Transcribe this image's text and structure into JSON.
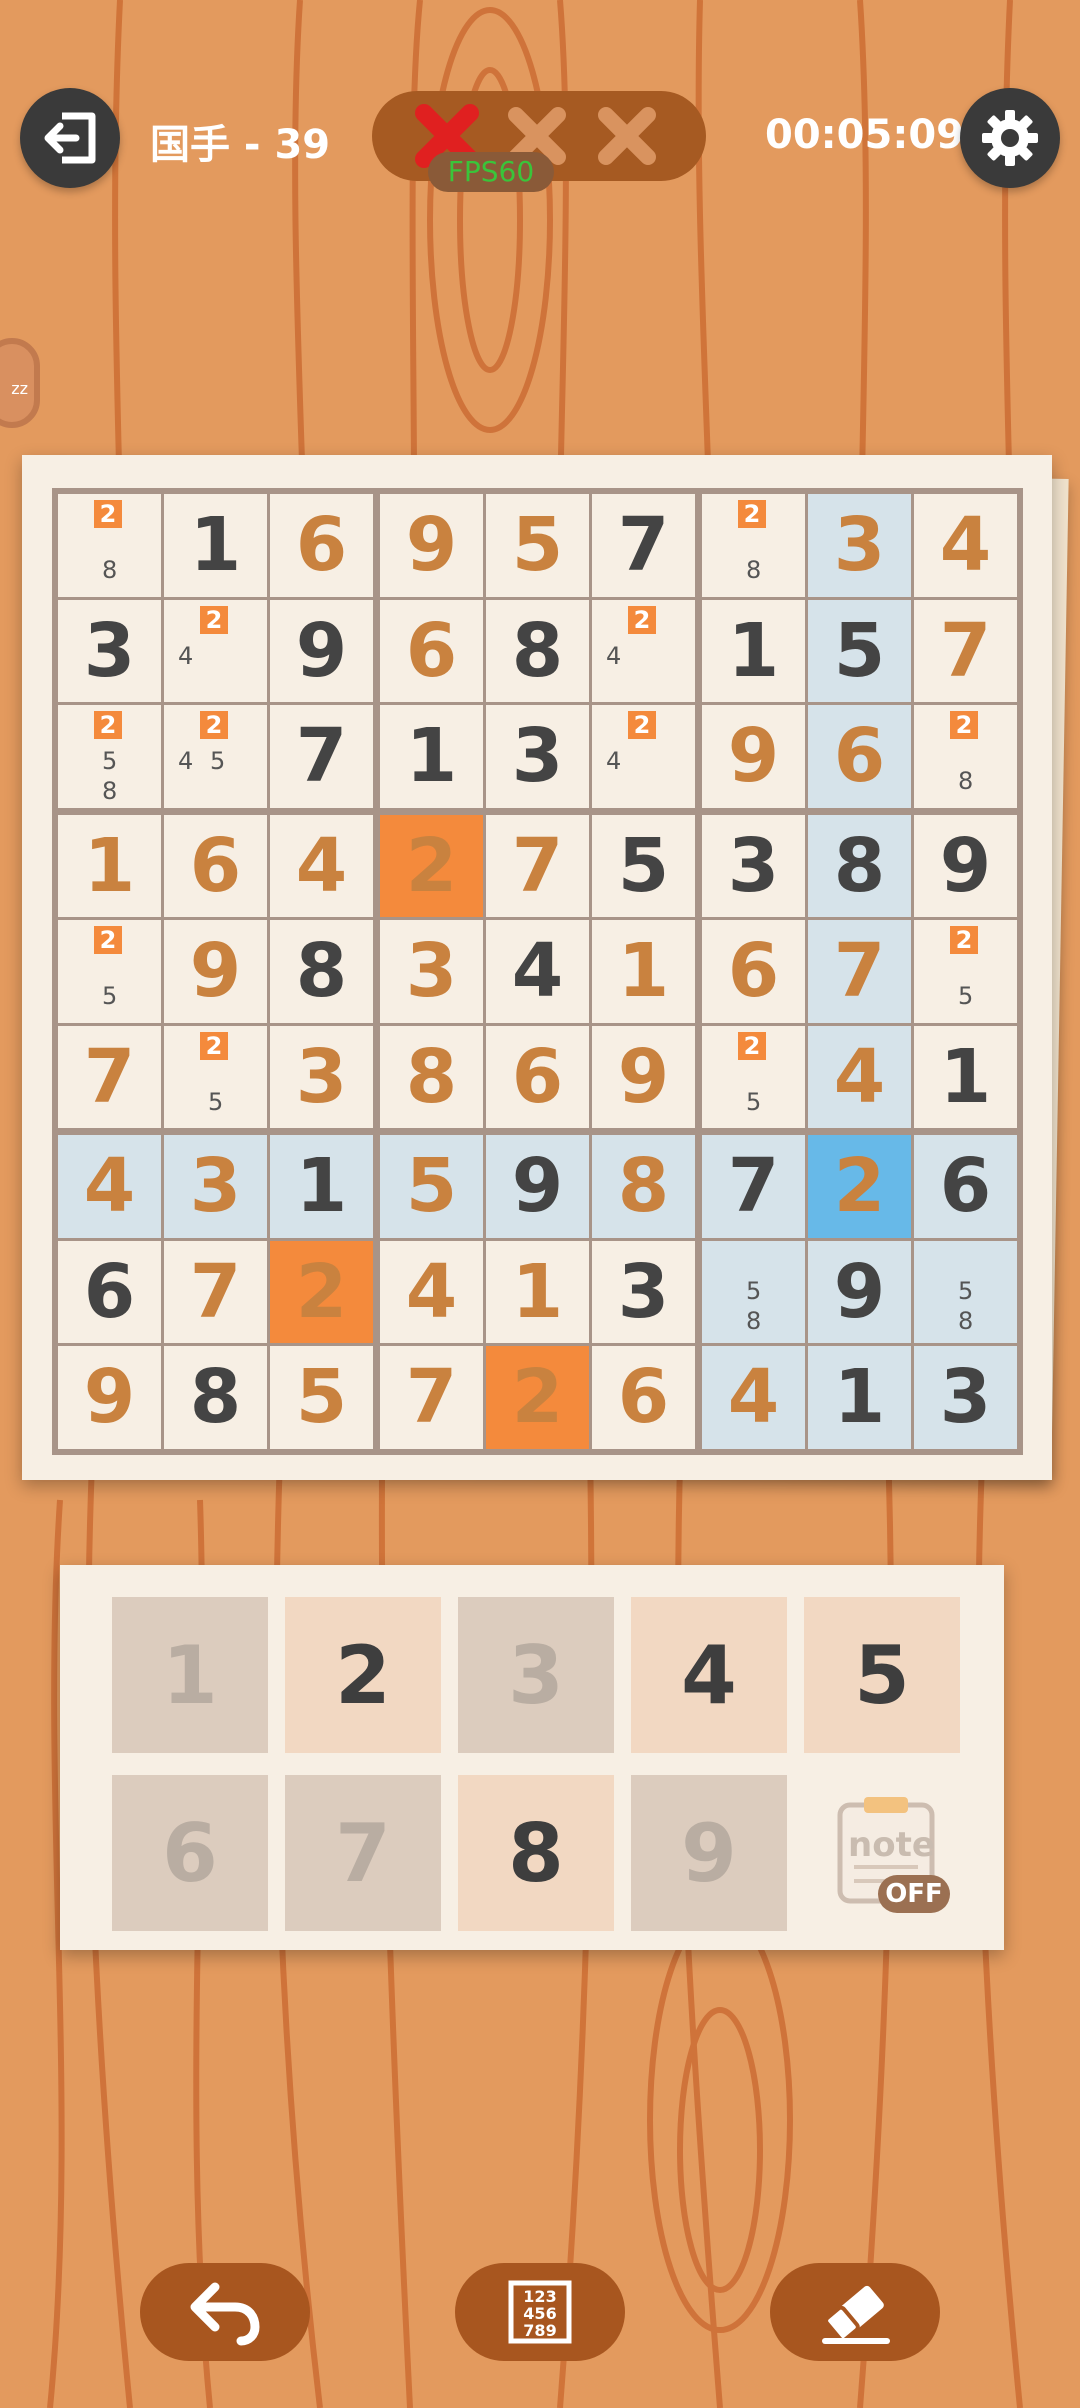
{
  "header": {
    "level_title": "国手 - 39",
    "timer": "00:05:09",
    "fps_label": "FPS60",
    "mistakes": [
      true,
      false,
      false
    ],
    "side_timer_label": "zz",
    "exit_icon": "exit-icon",
    "settings_icon": "gear-icon"
  },
  "board": {
    "cells": [
      [
        {
          "v": "",
          "n": [
            "2",
            "8"
          ]
        },
        {
          "v": "1",
          "t": "given"
        },
        {
          "v": "6",
          "t": "user"
        },
        {
          "v": "9",
          "t": "user"
        },
        {
          "v": "5",
          "t": "user"
        },
        {
          "v": "7",
          "t": "given"
        },
        {
          "v": "",
          "n": [
            "2",
            "8"
          ]
        },
        {
          "v": "3",
          "t": "user"
        },
        {
          "v": "4",
          "t": "user"
        }
      ],
      [
        {
          "v": "3",
          "t": "given"
        },
        {
          "v": "",
          "n": [
            "2",
            "4"
          ]
        },
        {
          "v": "9",
          "t": "given"
        },
        {
          "v": "6",
          "t": "user"
        },
        {
          "v": "8",
          "t": "given"
        },
        {
          "v": "",
          "n": [
            "2",
            "4"
          ]
        },
        {
          "v": "1",
          "t": "given"
        },
        {
          "v": "5",
          "t": "given"
        },
        {
          "v": "7",
          "t": "user"
        }
      ],
      [
        {
          "v": "",
          "n": [
            "2",
            "5",
            "8"
          ]
        },
        {
          "v": "",
          "n": [
            "2",
            "4",
            "5"
          ]
        },
        {
          "v": "7",
          "t": "given"
        },
        {
          "v": "1",
          "t": "given"
        },
        {
          "v": "3",
          "t": "given"
        },
        {
          "v": "",
          "n": [
            "2",
            "4"
          ]
        },
        {
          "v": "9",
          "t": "user"
        },
        {
          "v": "6",
          "t": "user"
        },
        {
          "v": "",
          "n": [
            "2",
            "8"
          ]
        }
      ],
      [
        {
          "v": "1",
          "t": "user"
        },
        {
          "v": "6",
          "t": "user"
        },
        {
          "v": "4",
          "t": "user"
        },
        {
          "v": "2",
          "t": "conf"
        },
        {
          "v": "7",
          "t": "user"
        },
        {
          "v": "5",
          "t": "given"
        },
        {
          "v": "3",
          "t": "given"
        },
        {
          "v": "8",
          "t": "given"
        },
        {
          "v": "9",
          "t": "given"
        }
      ],
      [
        {
          "v": "",
          "n": [
            "2",
            "5"
          ]
        },
        {
          "v": "9",
          "t": "user"
        },
        {
          "v": "8",
          "t": "given"
        },
        {
          "v": "3",
          "t": "user"
        },
        {
          "v": "4",
          "t": "given"
        },
        {
          "v": "1",
          "t": "user"
        },
        {
          "v": "6",
          "t": "user"
        },
        {
          "v": "7",
          "t": "user"
        },
        {
          "v": "",
          "n": [
            "2",
            "5"
          ]
        }
      ],
      [
        {
          "v": "7",
          "t": "user"
        },
        {
          "v": "",
          "n": [
            "2",
            "5"
          ]
        },
        {
          "v": "3",
          "t": "user"
        },
        {
          "v": "8",
          "t": "user"
        },
        {
          "v": "6",
          "t": "user"
        },
        {
          "v": "9",
          "t": "user"
        },
        {
          "v": "",
          "n": [
            "2",
            "5"
          ]
        },
        {
          "v": "4",
          "t": "user"
        },
        {
          "v": "1",
          "t": "given"
        }
      ],
      [
        {
          "v": "4",
          "t": "user"
        },
        {
          "v": "3",
          "t": "user"
        },
        {
          "v": "1",
          "t": "given"
        },
        {
          "v": "5",
          "t": "user"
        },
        {
          "v": "9",
          "t": "given"
        },
        {
          "v": "8",
          "t": "user"
        },
        {
          "v": "7",
          "t": "given"
        },
        {
          "v": "2",
          "t": "sel"
        },
        {
          "v": "6",
          "t": "given"
        }
      ],
      [
        {
          "v": "6",
          "t": "given"
        },
        {
          "v": "7",
          "t": "user"
        },
        {
          "v": "2",
          "t": "conf"
        },
        {
          "v": "4",
          "t": "user"
        },
        {
          "v": "1",
          "t": "user"
        },
        {
          "v": "3",
          "t": "given"
        },
        {
          "v": "",
          "n": [
            "5",
            "8"
          ]
        },
        {
          "v": "9",
          "t": "given"
        },
        {
          "v": "",
          "n": [
            "5",
            "8"
          ]
        }
      ],
      [
        {
          "v": "9",
          "t": "user"
        },
        {
          "v": "8",
          "t": "given"
        },
        {
          "v": "5",
          "t": "user"
        },
        {
          "v": "7",
          "t": "user"
        },
        {
          "v": "2",
          "t": "conf"
        },
        {
          "v": "6",
          "t": "user"
        },
        {
          "v": "4",
          "t": "user"
        },
        {
          "v": "1",
          "t": "given"
        },
        {
          "v": "3",
          "t": "given"
        }
      ]
    ],
    "highlighted_row": 6,
    "highlighted_col": 7,
    "highlighted_box": [
      6,
      6
    ]
  },
  "numpad": {
    "keys": [
      {
        "label": "1",
        "state": "done"
      },
      {
        "label": "2",
        "state": "avail"
      },
      {
        "label": "3",
        "state": "done"
      },
      {
        "label": "4",
        "state": "avail"
      },
      {
        "label": "5",
        "state": "avail"
      },
      {
        "label": "6",
        "state": "done"
      },
      {
        "label": "7",
        "state": "done"
      },
      {
        "label": "8",
        "state": "avail"
      },
      {
        "label": "9",
        "state": "done"
      }
    ],
    "note_label": "note",
    "note_state": "OFF"
  },
  "toolbar": {
    "items": [
      "undo-icon",
      "number-grid-icon",
      "eraser-icon"
    ],
    "grid_icon_digits": [
      "123",
      "456",
      "789"
    ]
  },
  "colors": {
    "background": "#e39a5e",
    "conflict": "#f48a3c",
    "selected": "#67b9e8",
    "highlight": "#d6e3ea",
    "given_digit": "#444444",
    "user_digit": "#c9823f"
  }
}
